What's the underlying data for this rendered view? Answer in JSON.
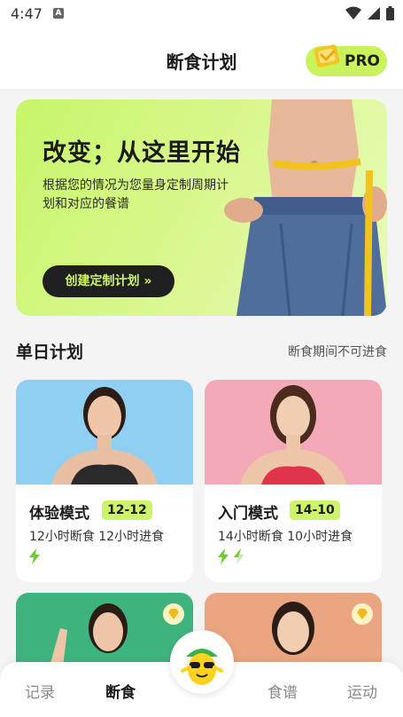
{
  "status_bar": {
    "time": "4:47",
    "notification_letter": "A"
  },
  "header": {
    "title": "断食计划",
    "pro_label": "PRO"
  },
  "banner": {
    "title": "改变；从这里开始",
    "description": "根据您的情况为您量身定制周期计划和对应的餐谱",
    "cta_label": "创建定制计划 »"
  },
  "section": {
    "title": "单日计划",
    "note": "断食期间不可进食"
  },
  "plans": [
    {
      "name": "体验模式",
      "badge": "12-12",
      "detail": "12小时断食  12小时进食",
      "bolts_full": 1,
      "bolts_half": 0
    },
    {
      "name": "入门模式",
      "badge": "14-10",
      "detail": "14小时断食  10小时进食",
      "bolts_full": 1,
      "bolts_half": 1
    }
  ],
  "tabs": [
    {
      "label": "记录",
      "active": false
    },
    {
      "label": "断食",
      "active": true
    },
    {
      "label": "食谱",
      "active": false
    },
    {
      "label": "运动",
      "active": false
    }
  ],
  "colors": {
    "accent": "#cdf36a",
    "dark": "#1f1f1f",
    "muted": "#8a8a8a"
  },
  "icons": [
    "wifi-icon",
    "signal-icon",
    "battery-icon",
    "crown-icon",
    "lightning-icon",
    "premium-diamond-icon",
    "mascot-icon"
  ]
}
